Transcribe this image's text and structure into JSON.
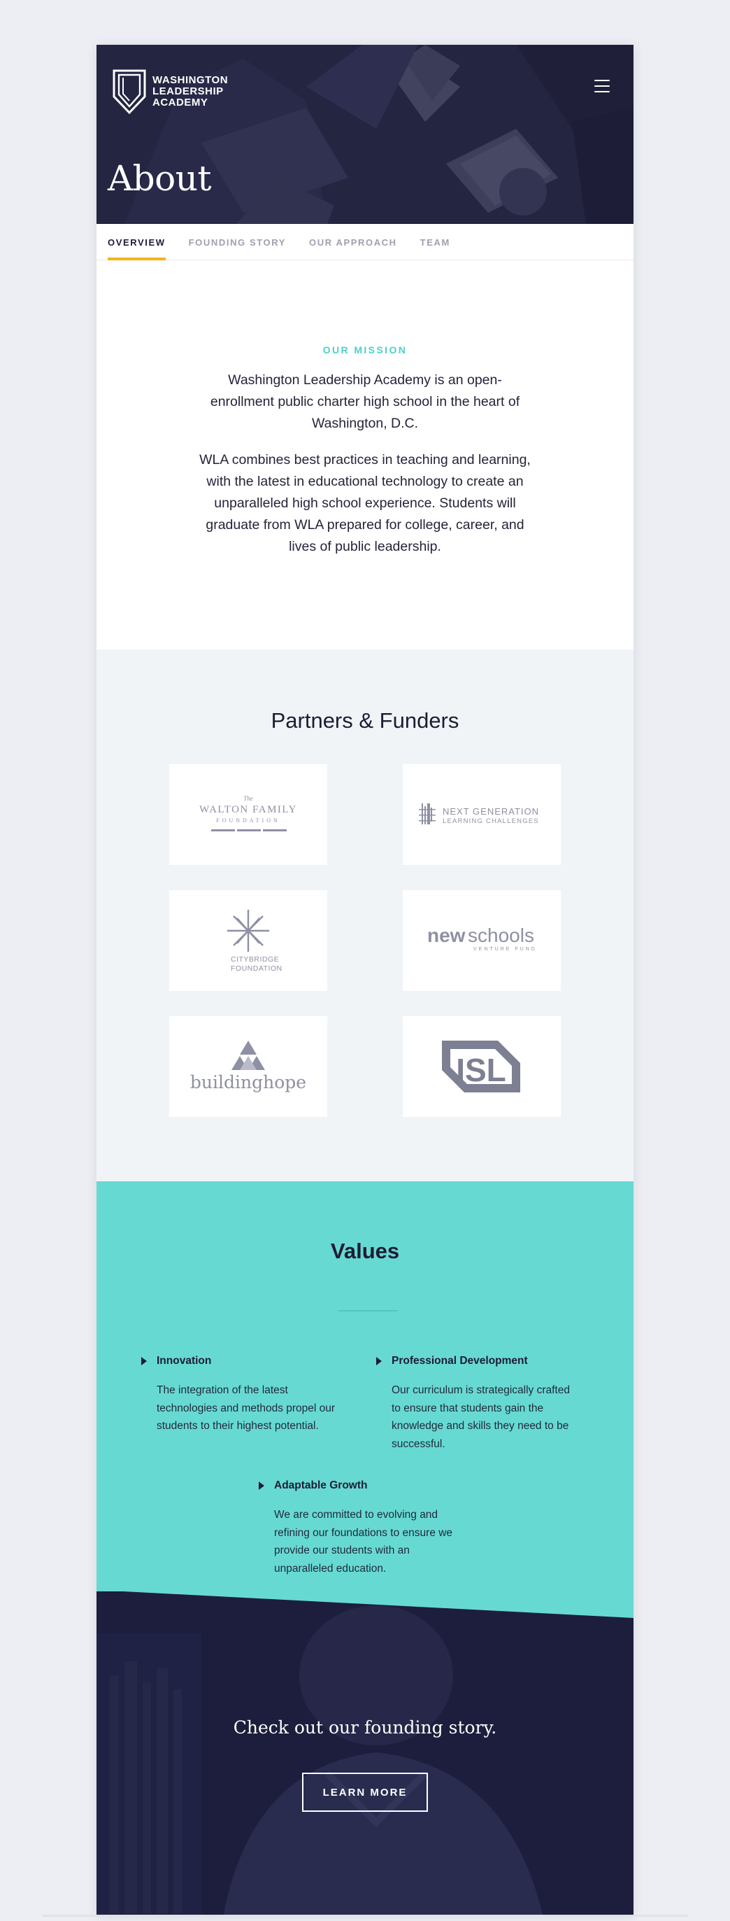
{
  "brand": {
    "name_lines": [
      "WASHINGTON",
      "LEADERSHIP",
      "ACADEMY"
    ]
  },
  "hero": {
    "title": "About"
  },
  "tabs": [
    {
      "label": "OVERVIEW",
      "active": true
    },
    {
      "label": "FOUNDING STORY",
      "active": false
    },
    {
      "label": "OUR APPROACH",
      "active": false
    },
    {
      "label": "TEAM",
      "active": false
    }
  ],
  "mission": {
    "label": "OUR MISSION",
    "paragraphs": [
      "Washington Leadership Academy is an open-enrollment public charter high school in the heart of Washington, D.C.",
      "WLA combines best practices in teaching and learning, with the latest in educational technology to create an unparalleled high school experience. Students will graduate from WLA prepared for college, career, and lives of public leadership."
    ]
  },
  "partners": {
    "title": "Partners & Funders",
    "logos": [
      {
        "name": "walton-family-foundation",
        "lines": [
          "The",
          "WALTON FAMILY",
          "FOUNDATION"
        ]
      },
      {
        "name": "next-generation-learning-challenges",
        "lines": [
          "NEXT GENERATION",
          "LEARNING CHALLENGES"
        ]
      },
      {
        "name": "citybridge-foundation",
        "lines": [
          "CITYBRIDGE",
          "FOUNDATION"
        ]
      },
      {
        "name": "newschools-venture-fund",
        "lines": [
          "new",
          "schools",
          "VENTURE FUND"
        ]
      },
      {
        "name": "building-hope",
        "lines": [
          "buildinghope"
        ]
      },
      {
        "name": "isl",
        "lines": [
          "ISL"
        ]
      }
    ]
  },
  "values": {
    "title": "Values",
    "items": [
      {
        "title": "Innovation",
        "body": "The integration of the latest technologies and methods propel our students to their highest potential."
      },
      {
        "title": "Professional Development",
        "body": "Our curriculum is strategically crafted to ensure that students gain the knowledge and skills they need to be successful."
      },
      {
        "title": "Adaptable Growth",
        "body": "We are committed to evolving and refining our foundations to ensure we provide our students with an unparalleled education."
      }
    ]
  },
  "cta": {
    "heading": "Check out our founding story.",
    "button_label": "LEARN MORE"
  },
  "colors": {
    "navy": "#22233f",
    "accent_yellow": "#f5b41b",
    "teal": "#67d9d3",
    "teal_label": "#4cd1c8",
    "logo_gray": "#8e90a3"
  }
}
